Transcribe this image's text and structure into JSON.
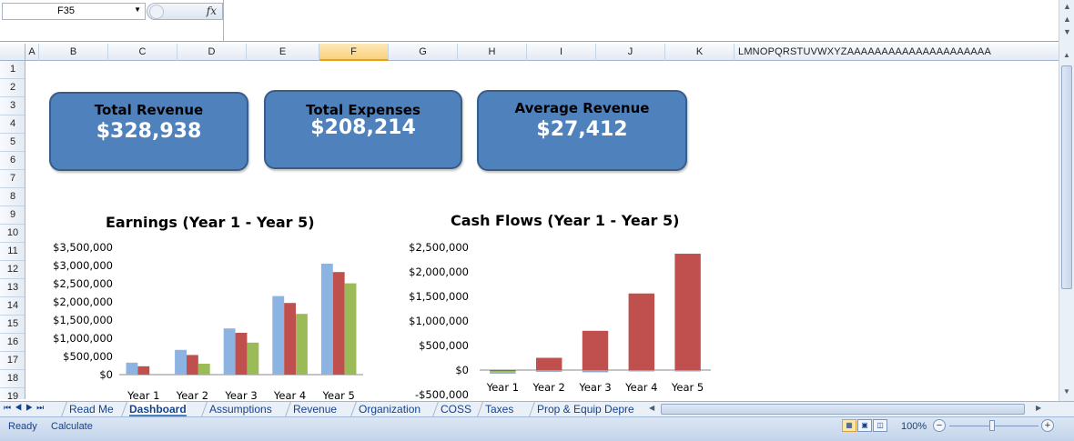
{
  "formula_bar": {
    "cell_ref": "F35",
    "fx_label": "fx",
    "formula": ""
  },
  "columns": [
    "A",
    "B",
    "C",
    "D",
    "E",
    "F",
    "G",
    "H",
    "I",
    "J",
    "K"
  ],
  "narrow_columns": "LMNOPQRSTUVWXYZAAAAAAAAAAAAAAAAAAAAA",
  "selected_column": "F",
  "rows": [
    "1",
    "2",
    "3",
    "4",
    "5",
    "6",
    "7",
    "8",
    "9",
    "10",
    "11",
    "12",
    "13",
    "14",
    "15",
    "16",
    "17",
    "18",
    "19"
  ],
  "kpis": [
    {
      "label": "Total Revenue",
      "value": "$328,938"
    },
    {
      "label": "Total Expenses",
      "value": "$208,214"
    },
    {
      "label": "Average Revenue",
      "value": "$27,412"
    }
  ],
  "chart_data": [
    {
      "type": "bar",
      "title": "Earnings (Year 1 - Year 5)",
      "categories": [
        "Year 1",
        "Year 2",
        "Year 3",
        "Year 4",
        "Year 5"
      ],
      "series": [
        {
          "color": "#8db3e2",
          "values": [
            330000,
            680000,
            1270000,
            2160000,
            3050000
          ]
        },
        {
          "color": "#c0504d",
          "values": [
            230000,
            540000,
            1150000,
            1970000,
            2820000
          ]
        },
        {
          "color": "#9bbb59",
          "values": [
            0,
            300000,
            880000,
            1670000,
            2510000
          ]
        }
      ],
      "ylim": [
        0,
        3500000
      ],
      "yticks": [
        0,
        500000,
        1000000,
        1500000,
        2000000,
        2500000,
        3000000,
        3500000
      ],
      "ytick_labels": [
        "$0",
        "$500,000",
        "$1,000,000",
        "$1,500,000",
        "$2,000,000",
        "$2,500,000",
        "$3,000,000",
        "$3,500,000"
      ]
    },
    {
      "type": "bar",
      "title": "Cash Flows (Year 1 - Year 5)",
      "categories": [
        "Year 1",
        "Year 2",
        "Year 3",
        "Year 4",
        "Year 5"
      ],
      "series": [
        {
          "color": "#c0504d",
          "values": [
            -20000,
            250000,
            800000,
            1560000,
            2370000
          ]
        },
        {
          "color": "#9bbb59",
          "values": [
            -30000,
            -5000,
            -5000,
            -5000,
            -5000
          ]
        },
        {
          "color": "#8da7c7",
          "values": [
            -20000,
            -30000,
            -40000,
            -10000,
            -10000
          ]
        }
      ],
      "ylim": [
        -500000,
        2500000
      ],
      "yticks": [
        -500000,
        0,
        500000,
        1000000,
        1500000,
        2000000,
        2500000
      ],
      "ytick_labels": [
        "-$500,000",
        "$0",
        "$500,000",
        "$1,000,000",
        "$1,500,000",
        "$2,000,000",
        "$2,500,000"
      ]
    }
  ],
  "tabs": [
    "Read Me",
    "Dashboard",
    "Assumptions",
    "Revenue",
    "Organization",
    "COSS",
    "Taxes",
    "Prop & Equip Depre"
  ],
  "active_tab": "Dashboard",
  "status": {
    "ready": "Ready",
    "calculate": "Calculate",
    "zoom": "100%"
  }
}
